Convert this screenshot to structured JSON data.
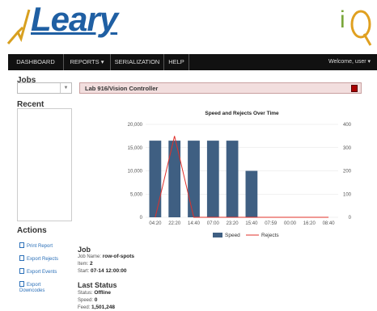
{
  "app": {
    "logo_text": "Leary",
    "logo_right_text": "iQ"
  },
  "nav": {
    "items": [
      {
        "label": "DASHBOARD"
      },
      {
        "label": "REPORTS ▾"
      },
      {
        "label": "SERIALIZATION"
      },
      {
        "label": "HELP"
      }
    ],
    "welcome": "Welcome, user ▾"
  },
  "sidebar": {
    "jobs_label": "Jobs",
    "recent_label": "Recent",
    "actions_label": "Actions",
    "actions": [
      {
        "label": "Print Report"
      },
      {
        "label": "Export Rejects"
      },
      {
        "label": "Export Events"
      },
      {
        "label": "Export Downcodes"
      }
    ]
  },
  "title_bar": {
    "text": "Lab 916/Vision Controller",
    "status_color": "#aa0000"
  },
  "job": {
    "heading": "Job",
    "name_label": "Job Name:",
    "name_value": "row-of-spots",
    "item_label": "Item:",
    "item_value": "2",
    "start_label": "Start:",
    "start_value": "07-14 12:00:00"
  },
  "last_status": {
    "heading": "Last Status",
    "status_label": "Status:",
    "status_value": "Offline",
    "speed_label": "Speed:",
    "speed_value": "0",
    "feed_label": "Feed:",
    "feed_value": "1,501,248"
  },
  "colors": {
    "nav_bg": "#111111",
    "bar_color": "#3f5f82",
    "line_color": "#e0302a",
    "link_color": "#2a6fb8"
  },
  "chart_data": {
    "type": "bar",
    "title": "Speed and Rejects Over Time",
    "categories": [
      "04:20",
      "22:20",
      "14:40",
      "07:00",
      "23:20",
      "15:40",
      "07:59",
      "00:00",
      "16:20",
      "08:40"
    ],
    "series": [
      {
        "name": "Speed",
        "type": "bar",
        "axis": "left",
        "values": [
          16500,
          16500,
          16500,
          16500,
          16500,
          10000,
          0,
          0,
          0,
          0
        ]
      },
      {
        "name": "Rejects",
        "type": "line",
        "axis": "right",
        "values": [
          0,
          350,
          0,
          0,
          0,
          0,
          0,
          0,
          0,
          0
        ]
      }
    ],
    "y_left_ticks": [
      "0",
      "5,000",
      "10,000",
      "15,000",
      "20,000"
    ],
    "y_right_ticks": [
      "0",
      "100",
      "200",
      "300",
      "400"
    ],
    "ylim_left": [
      0,
      20000
    ],
    "ylim_right": [
      0,
      400
    ],
    "grid": true,
    "legend_position": "bottom"
  }
}
